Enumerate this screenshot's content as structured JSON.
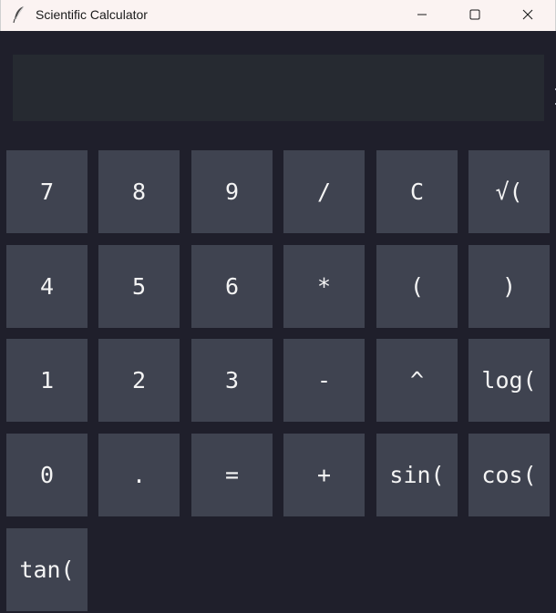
{
  "window": {
    "title": "Scientific Calculator",
    "icons": {
      "app": "feather-icon",
      "minimize": "minimize-icon",
      "maximize": "maximize-icon",
      "close": "close-icon"
    }
  },
  "display": {
    "value": ""
  },
  "keypad": {
    "rows": [
      [
        "7",
        "8",
        "9",
        "/",
        "C",
        "√("
      ],
      [
        "4",
        "5",
        "6",
        "*",
        "(",
        ")"
      ],
      [
        "1",
        "2",
        "3",
        "-",
        "^",
        "log("
      ],
      [
        "0",
        ".",
        "=",
        "+",
        "sin(",
        "cos("
      ],
      [
        "tan("
      ]
    ]
  },
  "colors": {
    "background": "#1f1f2b",
    "display": "#262a31",
    "key": "#3f4350",
    "key_text": "#f4f4f4",
    "titlebar": "#fbf3f2"
  }
}
